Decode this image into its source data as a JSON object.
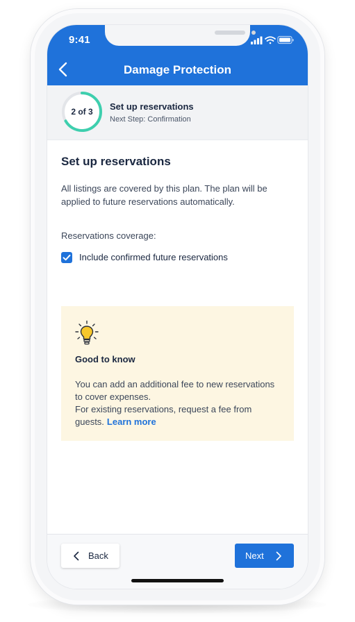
{
  "status_bar": {
    "time": "9:41"
  },
  "header": {
    "title": "Damage Protection",
    "back_icon": "chevron-left-icon"
  },
  "stepper": {
    "progress_label": "2 of 3",
    "progress_fraction": 0.667,
    "title": "Set up reservations",
    "next_step": "Next Step: Confirmation"
  },
  "content": {
    "heading": "Set up reservations",
    "description": "All listings are covered by this plan. The plan will be applied to future reservations automatically.",
    "coverage_label": "Reservations coverage:",
    "checkbox": {
      "label": "Include confirmed future reservations",
      "checked": true
    }
  },
  "tip": {
    "icon": "lightbulb-icon",
    "title": "Good to know",
    "line1": "You can add an additional fee to new reservations to cover expenses.",
    "line2": "For existing reservations, request a fee from guests.",
    "link": "Learn more"
  },
  "footer": {
    "back_label": "Back",
    "next_label": "Next"
  },
  "colors": {
    "primary": "#1f72da",
    "ring": "#3ecfae",
    "tip_bg": "#fdf6e2"
  }
}
